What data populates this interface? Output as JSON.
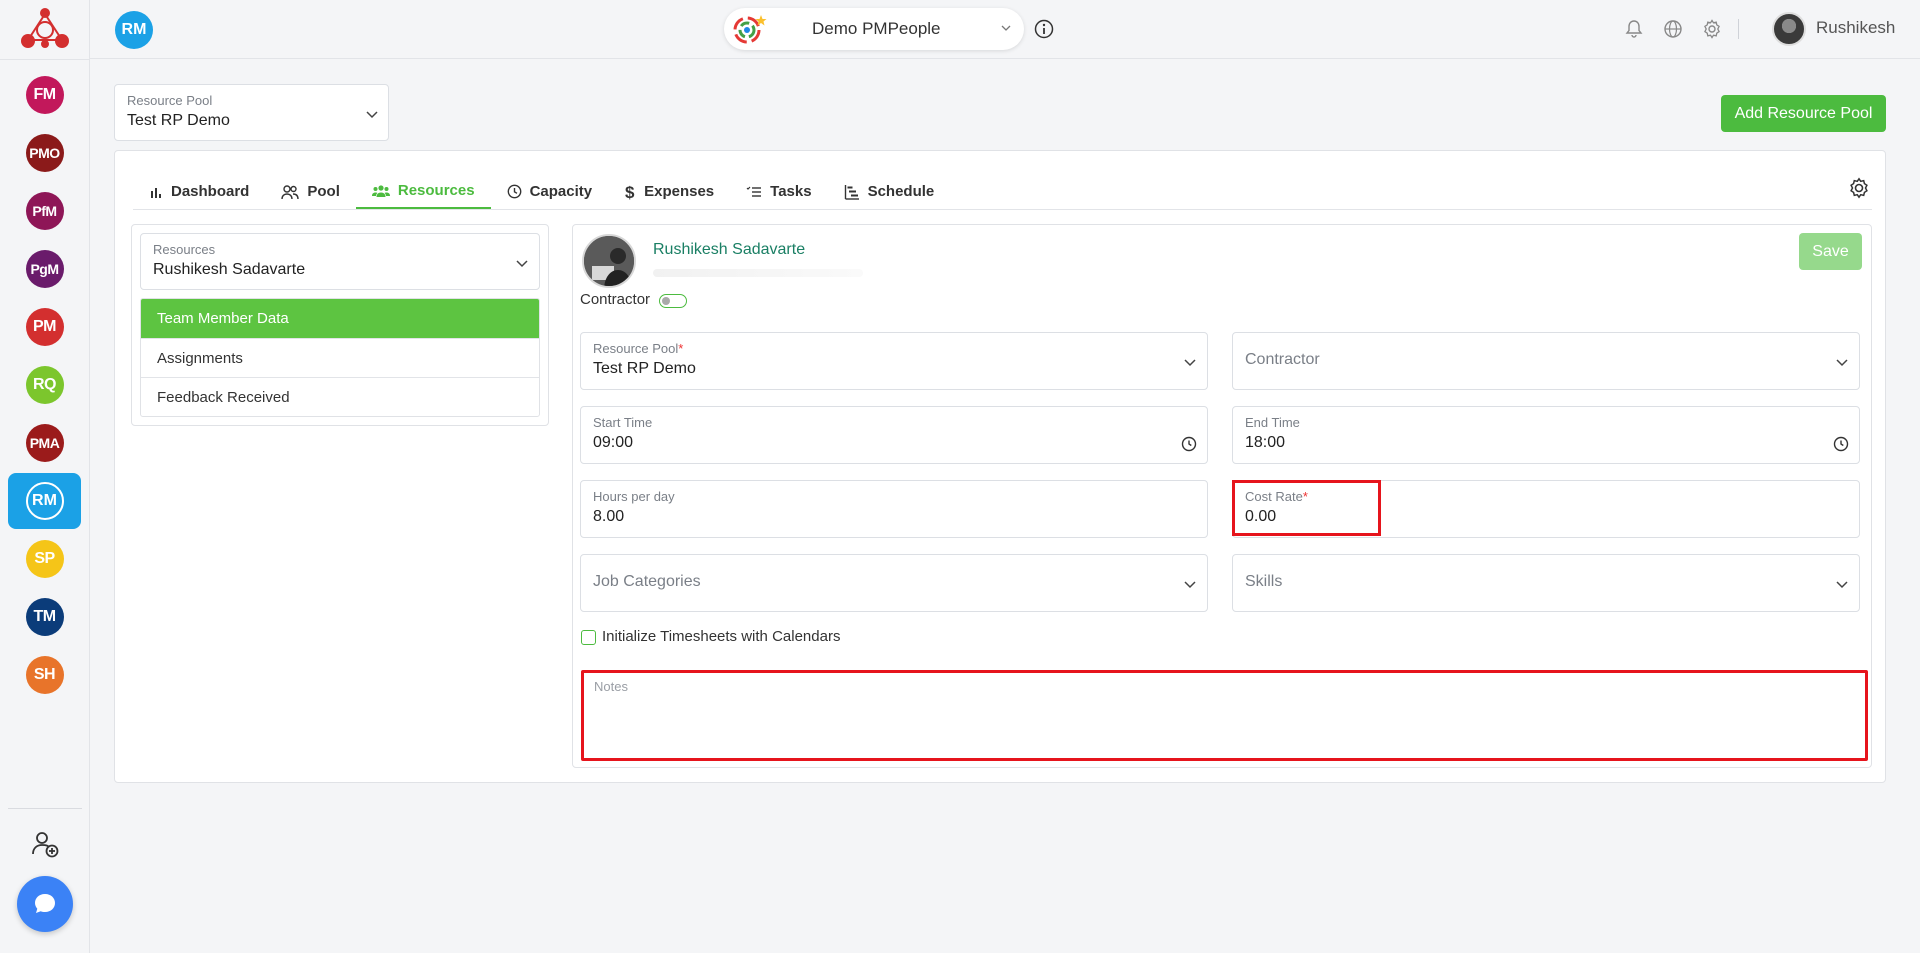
{
  "topbar": {
    "module_badge": "RM",
    "project_name": "Demo PMPeople",
    "user_name": "Rushikesh"
  },
  "rail": {
    "items": [
      {
        "label": "FM",
        "color": "#c2185b"
      },
      {
        "label": "PMO",
        "color": "#8b1a1a"
      },
      {
        "label": "PfM",
        "color": "#8e1657"
      },
      {
        "label": "PgM",
        "color": "#6a1b6b"
      },
      {
        "label": "PM",
        "color": "#d32f2f"
      },
      {
        "label": "RQ",
        "color": "#7cc62d"
      },
      {
        "label": "PMA",
        "color": "#9b1b1b"
      },
      {
        "label": "RM",
        "color": "#1ba1e6"
      },
      {
        "label": "SP",
        "color": "#f5c518"
      },
      {
        "label": "TM",
        "color": "#0b3c7a"
      },
      {
        "label": "SH",
        "color": "#e8742a"
      }
    ]
  },
  "pool_select": {
    "label": "Resource Pool",
    "value": "Test RP Demo"
  },
  "add_pool_button": "Add Resource Pool",
  "tabs": [
    {
      "label": "Dashboard",
      "icon": "bar-chart-icon"
    },
    {
      "label": "Pool",
      "icon": "people-icon"
    },
    {
      "label": "Resources",
      "icon": "team-icon"
    },
    {
      "label": "Capacity",
      "icon": "clock-icon"
    },
    {
      "label": "Expenses",
      "icon": "dollar-icon"
    },
    {
      "label": "Tasks",
      "icon": "tasks-icon"
    },
    {
      "label": "Schedule",
      "icon": "schedule-icon"
    }
  ],
  "left_panel": {
    "resource_select": {
      "label": "Resources",
      "value": "Rushikesh Sadavarte"
    },
    "menu": [
      "Team Member Data",
      "Assignments",
      "Feedback Received"
    ]
  },
  "profile": {
    "name": "Rushikesh Sadavarte",
    "save_label": "Save",
    "contractor_label": "Contractor"
  },
  "form": {
    "resource_pool": {
      "label": "Resource Pool",
      "value": "Test RP Demo"
    },
    "contractor": {
      "placeholder": "Contractor"
    },
    "start_time": {
      "label": "Start Time",
      "value": "09:00"
    },
    "end_time": {
      "label": "End Time",
      "value": "18:00"
    },
    "hours_per_day": {
      "label": "Hours per day",
      "value": "8.00"
    },
    "cost_rate": {
      "label": "Cost Rate",
      "value": "0.00"
    },
    "job_categories": {
      "placeholder": "Job Categories"
    },
    "skills": {
      "placeholder": "Skills"
    },
    "init_timesheets": {
      "label": "Initialize Timesheets with Calendars"
    },
    "notes": {
      "label": "Notes"
    }
  },
  "required_mark": "*"
}
